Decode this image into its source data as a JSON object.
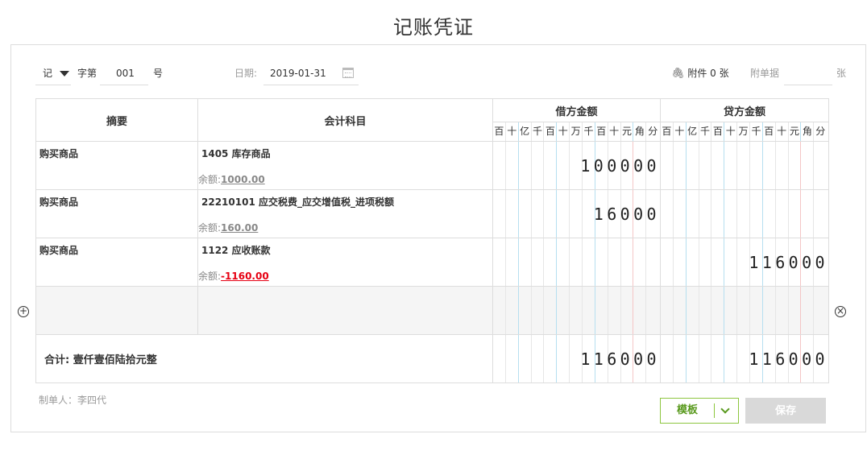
{
  "title": "记账凭证",
  "header": {
    "voucher_type": "记",
    "zi_label": "字第",
    "number": "001",
    "hao_label": "号",
    "date_label": "日期:",
    "date_value": "2019-01-31",
    "attachment_text": "附件 0 张",
    "doc_label": "附单据",
    "doc_value": "",
    "zhang_label": "张"
  },
  "table": {
    "col_summary": "摘要",
    "col_subject": "会计科目",
    "col_debit": "借方金额",
    "col_credit": "贷方金额",
    "digit_units": [
      "百",
      "十",
      "亿",
      "千",
      "百",
      "十",
      "万",
      "千",
      "百",
      "十",
      "元",
      "角",
      "分"
    ],
    "rows": [
      {
        "summary": "购买商品",
        "subject": "1405 库存商品",
        "balance_label": "余额:",
        "balance": "1000.00",
        "debit": "100000",
        "credit": ""
      },
      {
        "summary": "购买商品",
        "subject": "22210101 应交税费_应交增值税_进项税额",
        "balance_label": "余额:",
        "balance": "160.00",
        "debit": "16000",
        "credit": ""
      },
      {
        "summary": "购买商品",
        "subject": "1122 应收账款",
        "balance_label": "余额:",
        "balance": "-1160.00",
        "debit": "",
        "credit": "116000"
      }
    ],
    "total_label": "合计:",
    "total_words": "壹仟壹佰陆拾元整",
    "total_debit": "116000",
    "total_credit": "116000"
  },
  "footer": {
    "maker": "制单人：李四代",
    "template_button": "模板",
    "save_button": "保存"
  },
  "colors": {
    "accent_green": "#8dc63f",
    "negative_red": "#e60012",
    "disabled_gray": "#d9d9d9"
  },
  "icons": [
    "chevron-down-icon",
    "calendar-icon",
    "paperclip-icon",
    "add-row-icon",
    "delete-row-icon"
  ]
}
